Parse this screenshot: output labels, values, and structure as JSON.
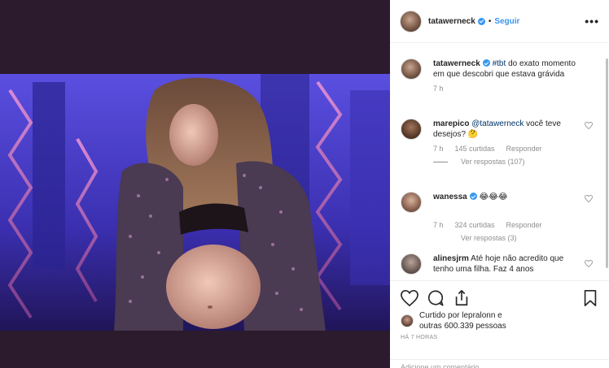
{
  "post": {
    "username": "tatawerneck",
    "follow_label": "Seguir",
    "more_label": "•••"
  },
  "caption": {
    "username": "tatawerneck",
    "hashtag": "#tbt",
    "text": "do exato momento em que descobri que estava grávida",
    "time": "7 h"
  },
  "comments": [
    {
      "username": "marepico",
      "mention": "@tatawerneck",
      "text": "você teve desejos? 🤔",
      "time": "7 h",
      "likes": "145 curtidas",
      "reply_label": "Responder",
      "view_replies": "Ver respostas (107)"
    },
    {
      "username": "wanessa",
      "text": "😂😂😂",
      "time": "7 h",
      "likes": "324 curtidas",
      "reply_label": "Responder",
      "view_replies": "Ver respostas (3)"
    },
    {
      "username": "alinesjrm",
      "text": "Até hoje não acredito que tenho uma filha. Faz 4 anos"
    }
  ],
  "liked_by": {
    "line1": "Curtido por lepralonn e",
    "line2": "outras 600.339 pessoas"
  },
  "timestamp": "HÁ 7 HORAS",
  "add_comment_placeholder": "Adicione um comentário..."
}
